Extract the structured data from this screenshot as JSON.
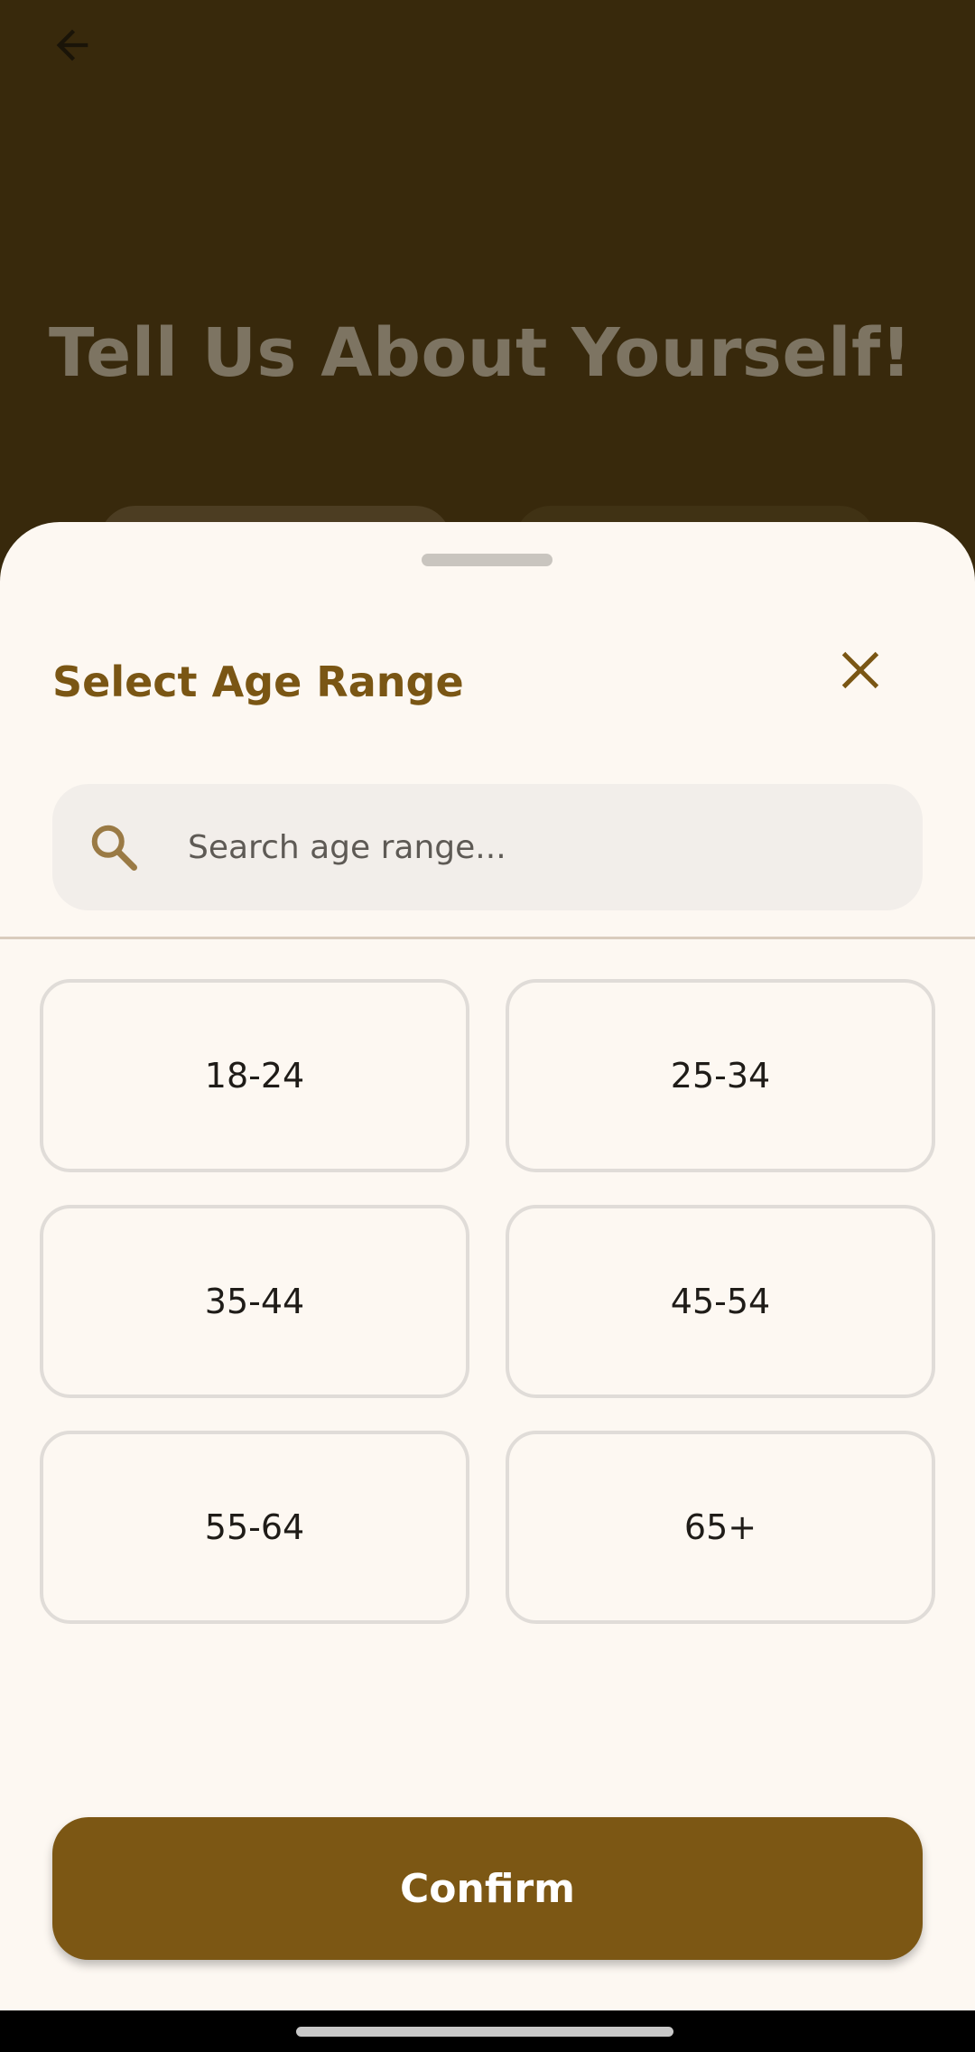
{
  "background_page": {
    "title": "Tell Us About Yourself!",
    "back_icon": "arrow-left-icon"
  },
  "sheet": {
    "title": "Select Age Range",
    "close_icon": "close-icon",
    "search": {
      "icon": "search-icon",
      "placeholder": "Search age range...",
      "value": ""
    },
    "options": [
      "18-24",
      "25-34",
      "35-44",
      "45-54",
      "55-64",
      "65+"
    ],
    "confirm_label": "Confirm"
  },
  "colors": {
    "accent": "#7c5714",
    "title_color": "#7a5614",
    "sheet_background": "#fdf8f2",
    "overlay_background": "#38290c"
  }
}
